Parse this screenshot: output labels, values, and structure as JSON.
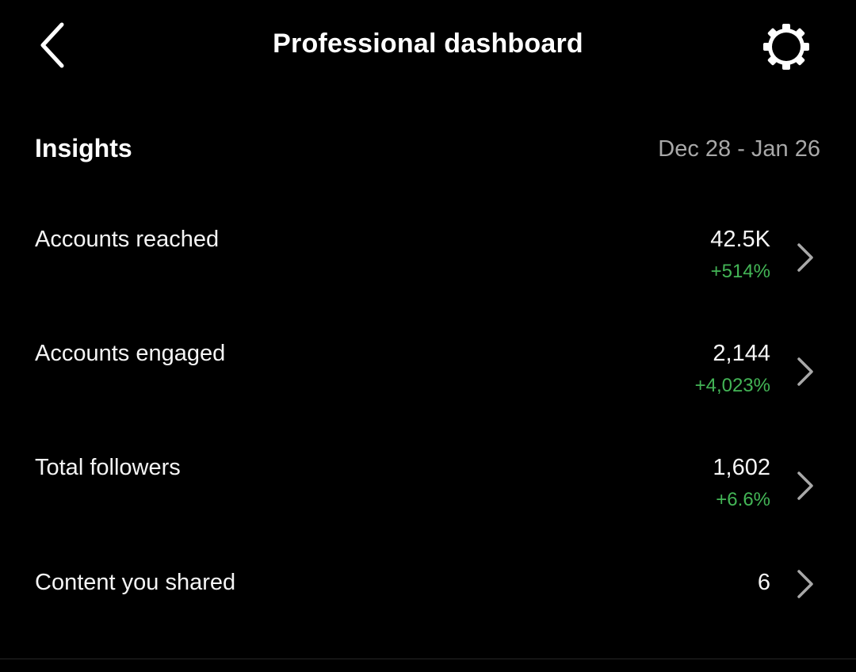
{
  "header": {
    "title": "Professional dashboard",
    "back_icon": "chevron-left-icon",
    "settings_icon": "gear-icon"
  },
  "insights": {
    "title": "Insights",
    "date_range": "Dec 28 - Jan 26",
    "rows": [
      {
        "label": "Accounts reached",
        "value": "42.5K",
        "change": "+514%"
      },
      {
        "label": "Accounts engaged",
        "value": "2,144",
        "change": "+4,023%"
      },
      {
        "label": "Total followers",
        "value": "1,602",
        "change": "+6.6%"
      },
      {
        "label": "Content you shared",
        "value": "6",
        "change": ""
      }
    ]
  },
  "colors": {
    "background": "#000000",
    "text": "#f5f5f5",
    "muted_text": "#a8a8a8",
    "positive_change": "#43b556",
    "chevron": "#a8a8a8"
  }
}
